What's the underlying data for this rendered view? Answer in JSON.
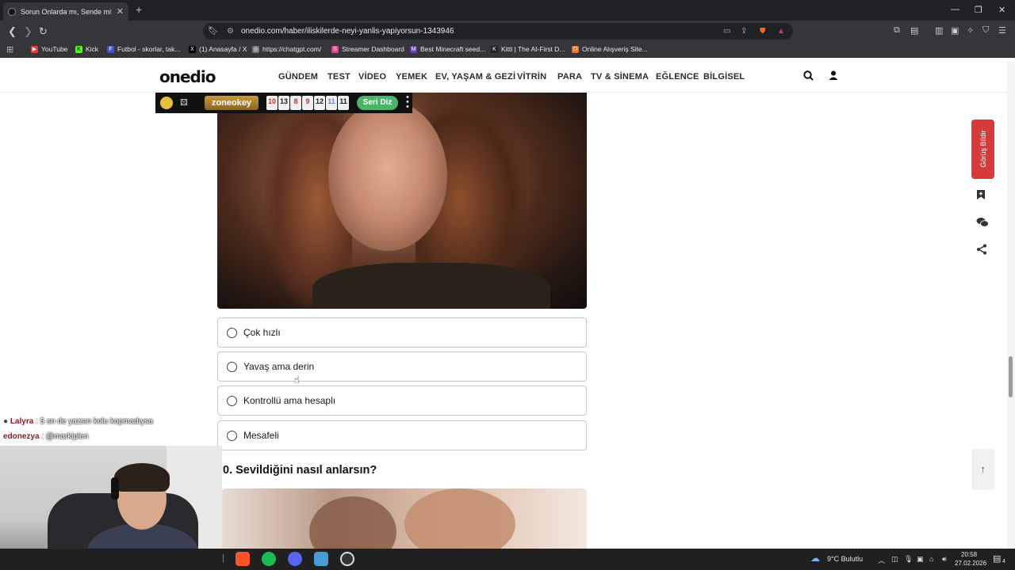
{
  "browser": {
    "tab_title": "Sorun Onlarda mı, Sende mi? - O",
    "new_tab": "+",
    "url": "onedio.com/haber/iliskilerde-neyi-yanlis-yapiyorsun-1343946",
    "bookmarks": [
      {
        "label": "YouTube",
        "color": "#e53935",
        "glyph": "▶"
      },
      {
        "label": "Kick",
        "color": "#53fc18",
        "glyph": "K"
      },
      {
        "label": "Futbol - skorlar, tak...",
        "color": "#4b52d1",
        "glyph": "F"
      },
      {
        "label": "(1) Anasayfa / X",
        "color": "#000000",
        "glyph": "X"
      },
      {
        "label": "https://chatgpt.com/",
        "color": "#777777",
        "glyph": "◎"
      },
      {
        "label": "Streamer Dashboard",
        "color": "#d64c8f",
        "glyph": "S"
      },
      {
        "label": "Best Minecraft seed...",
        "color": "#6a3fb5",
        "glyph": "M"
      },
      {
        "label": "Kittl | The AI-First D...",
        "color": "#222222",
        "glyph": "K"
      },
      {
        "label": "Online Alışveriş Site...",
        "color": "#e8772e",
        "glyph": "O"
      }
    ]
  },
  "site": {
    "logo": "onedio",
    "nav": [
      "GÜNDEM",
      "TEST",
      "VİDEO",
      "YEMEK",
      "EV, YAŞAM & GEZİ",
      "VİTRİN",
      "PARA",
      "TV & SİNEMA",
      "EĞLENCE",
      "BİLGİSEL"
    ]
  },
  "overlay": {
    "zone_label": "zoneokey",
    "tiles": [
      "10",
      "13",
      "8",
      "9",
      "12",
      "11",
      "11"
    ],
    "tile_colors": [
      "#c23030",
      "#1a1a1a",
      "#c23030",
      "#c23030",
      "#1a1a1a",
      "#6b7fd6",
      "#1a1a1a"
    ],
    "seri_diz": "Seri Diz"
  },
  "quiz": {
    "options": [
      "Çok hızlı",
      "Yavaş ama derin",
      "Kontrollü ama hesaplı",
      "Mesafeli"
    ],
    "next_question": "0. Sevildiğini nasıl anlarsın?"
  },
  "side": {
    "feedback": "Görüş Bildir",
    "top_arrow": "↑"
  },
  "chat": [
    {
      "user": "Lalyra",
      "msg": ": 5 sn de yazsın kolu kopmadıysa"
    },
    {
      "user": "edonezya",
      "msg": ": @markiplen"
    }
  ],
  "taskbar": {
    "weather": "9°C  Bulutlu",
    "time": "20:58",
    "date": "27.02.2026",
    "notif_count": "4"
  }
}
